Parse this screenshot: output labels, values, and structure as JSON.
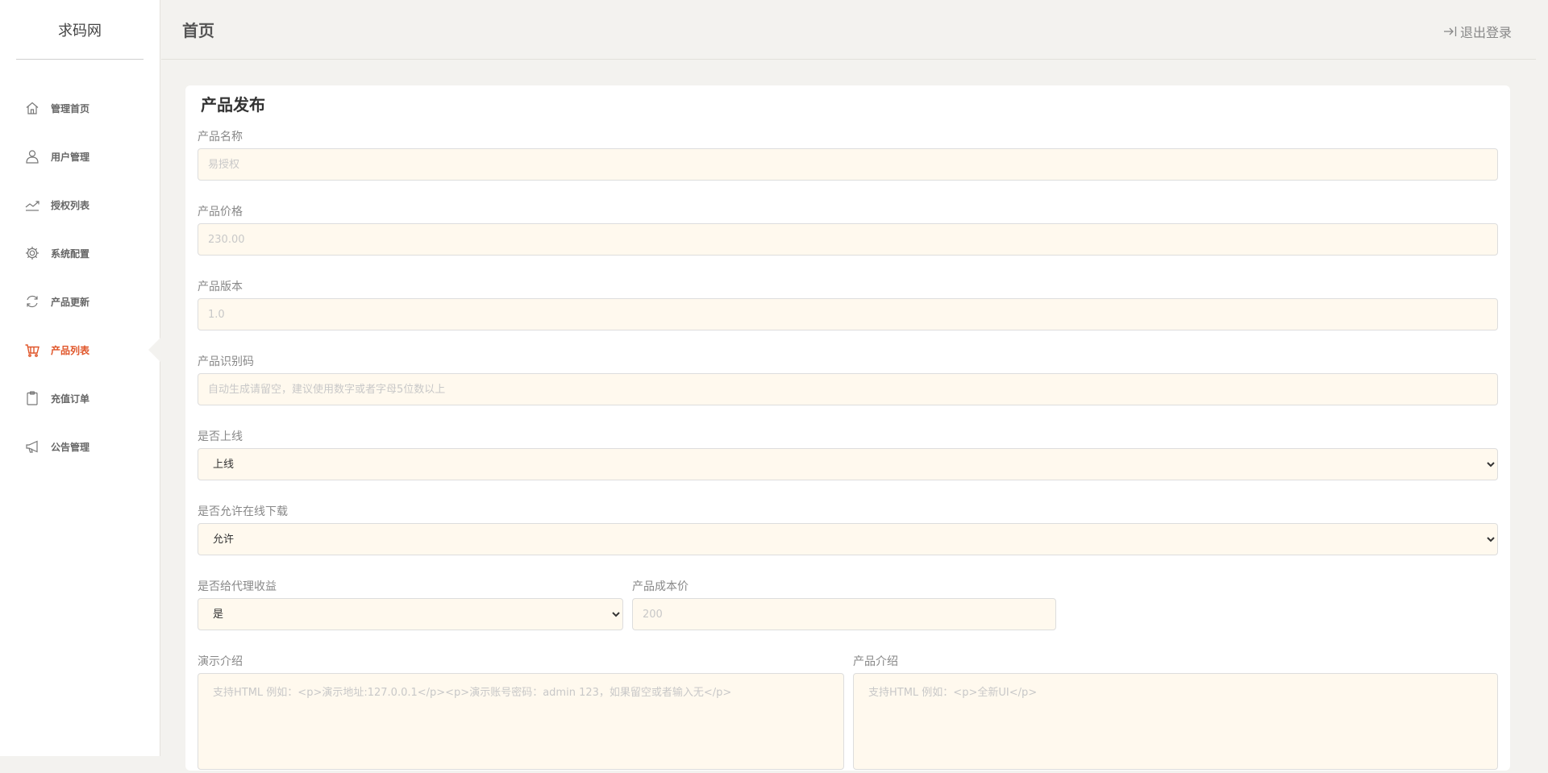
{
  "app": {
    "brand": "求码网"
  },
  "sidebar": {
    "items": [
      {
        "label": "管理首页",
        "icon": "home-icon"
      },
      {
        "label": "用户管理",
        "icon": "user-icon"
      },
      {
        "label": "授权列表",
        "icon": "trend-icon"
      },
      {
        "label": "系统配置",
        "icon": "gear-icon"
      },
      {
        "label": "产品更新",
        "icon": "refresh-icon"
      },
      {
        "label": "产品列表",
        "icon": "cart-icon",
        "active": true
      },
      {
        "label": "充值订单",
        "icon": "clipboard-icon"
      },
      {
        "label": "公告管理",
        "icon": "megaphone-icon"
      }
    ]
  },
  "header": {
    "title": "首页",
    "logout_label": "退出登录"
  },
  "form": {
    "title": "产品发布",
    "name": {
      "label": "产品名称",
      "placeholder": "易授权"
    },
    "price": {
      "label": "产品价格",
      "placeholder": "230.00"
    },
    "version": {
      "label": "产品版本",
      "placeholder": "1.0"
    },
    "code": {
      "label": "产品识别码",
      "placeholder": "自动生成请留空，建议使用数字或者字母5位数以上"
    },
    "online": {
      "label": "是否上线",
      "value": "上线"
    },
    "download": {
      "label": "是否允许在线下载",
      "value": "允许"
    },
    "agent": {
      "label": "是否给代理收益",
      "value": "是"
    },
    "cost": {
      "label": "产品成本价",
      "placeholder": "200"
    },
    "demo": {
      "label": "演示介绍",
      "placeholder": "支持HTML 例如：<p>演示地址:127.0.0.1</p><p>演示账号密码：admin 123，如果留空或者输入无</p>"
    },
    "intro": {
      "label": "产品介绍",
      "placeholder": "支持HTML 例如：<p>全新UI</p>"
    }
  },
  "colors": {
    "accent": "#e0562a",
    "input_bg": "#fff9ee",
    "page_bg": "#f3f2ef"
  }
}
